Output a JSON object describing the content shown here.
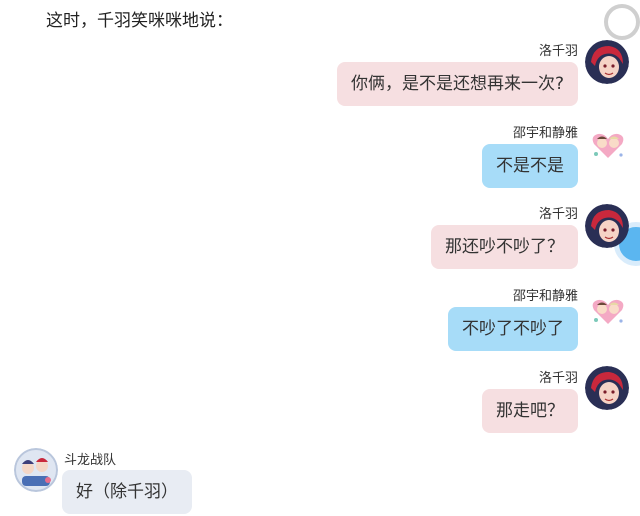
{
  "narration": "这时，千羽笑咪咪地说：",
  "messages": [
    {
      "sender": "洛千羽",
      "text": "你俩，是不是还想再来一次?"
    },
    {
      "sender": "邵宇和静雅",
      "text": "不是不是"
    },
    {
      "sender": "洛千羽",
      "text": "那还吵不吵了？"
    },
    {
      "sender": "邵宇和静雅",
      "text": "不吵了不吵了"
    },
    {
      "sender": "洛千羽",
      "text": "那走吧？"
    },
    {
      "sender": "斗龙战队",
      "text": "好（除千羽）"
    }
  ],
  "colors": {
    "pink_bubble": "#f6dfe1",
    "blue_bubble": "#a7dcf8",
    "gray_bubble": "#e8ecf3",
    "overlay_button": "#5bb6f0"
  },
  "icons": {
    "luo_avatar": "red-haired-character-avatar",
    "shao_avatar": "heart-sticker-avatar",
    "team_avatar": "group-character-avatar"
  }
}
